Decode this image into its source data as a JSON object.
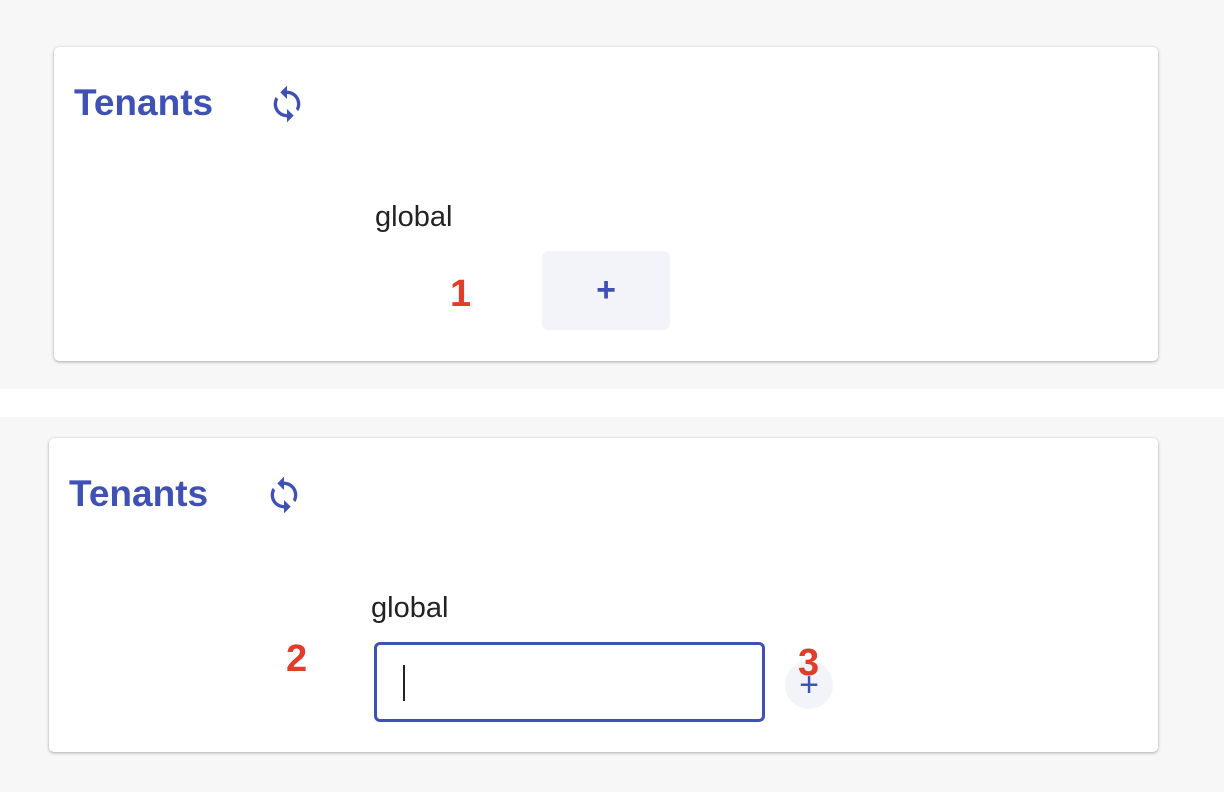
{
  "panels": [
    {
      "title": "Tenants",
      "tenant": "global",
      "add_button": "+",
      "marker": "1"
    },
    {
      "title": "Tenants",
      "tenant": "global",
      "input_value": "",
      "add_button": "+",
      "markers": [
        "2",
        "3"
      ]
    }
  ],
  "colors": {
    "accent": "#3f51b5",
    "marker": "#e23d28",
    "button_bg": "#f3f3fa"
  },
  "icons": {
    "refresh": "refresh-icon"
  }
}
